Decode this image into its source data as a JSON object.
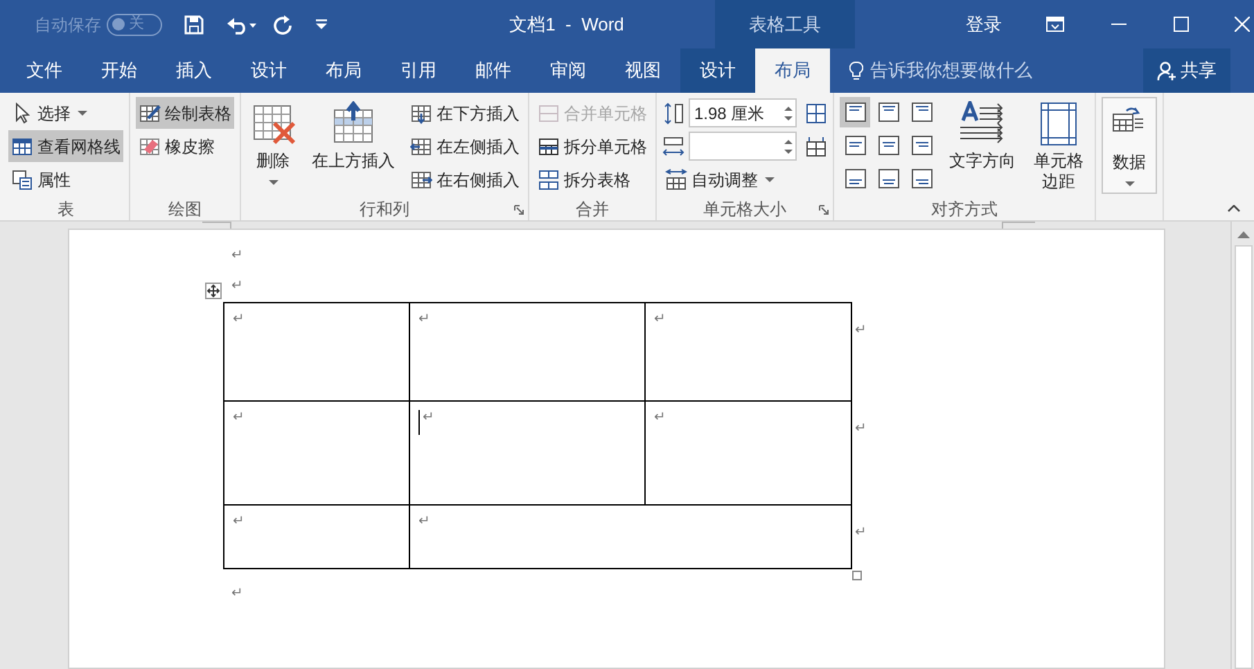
{
  "title_bar": {
    "autosave": {
      "label": "自动保存",
      "toggle": "关",
      "on": false
    },
    "title": "文档1  -  Word",
    "contextual_label": "表格工具",
    "sign_in": "登录"
  },
  "tabs": [
    {
      "label": "文件",
      "kind": "normal",
      "selected": false
    },
    {
      "label": "开始",
      "kind": "normal",
      "selected": false
    },
    {
      "label": "插入",
      "kind": "normal",
      "selected": false
    },
    {
      "label": "设计",
      "kind": "normal",
      "selected": false
    },
    {
      "label": "布局",
      "kind": "normal",
      "selected": false
    },
    {
      "label": "引用",
      "kind": "normal",
      "selected": false
    },
    {
      "label": "邮件",
      "kind": "normal",
      "selected": false
    },
    {
      "label": "审阅",
      "kind": "normal",
      "selected": false
    },
    {
      "label": "视图",
      "kind": "normal",
      "selected": false
    },
    {
      "label": "设计",
      "kind": "contextual",
      "selected": false
    },
    {
      "label": "布局",
      "kind": "contextual",
      "selected": true
    }
  ],
  "tell_me": "告诉我你想要做什么",
  "share": "共享",
  "ribbon": [
    {
      "label": "表",
      "launcher": false,
      "columns": [
        [
          {
            "kind": "small",
            "label": "选择",
            "dropdown": true,
            "selected": false,
            "disabled": false
          },
          {
            "kind": "small",
            "label": "查看网格线",
            "dropdown": false,
            "selected": true,
            "disabled": false
          },
          {
            "kind": "small",
            "label": "属性",
            "dropdown": false,
            "selected": false,
            "disabled": false
          }
        ]
      ]
    },
    {
      "label": "绘图",
      "launcher": false,
      "columns": [
        [
          {
            "kind": "small",
            "label": "绘制表格",
            "dropdown": false,
            "selected": true,
            "disabled": false
          },
          {
            "kind": "small",
            "label": "橡皮擦",
            "dropdown": false,
            "selected": false,
            "disabled": false
          }
        ]
      ]
    },
    {
      "label": "行和列",
      "launcher": true,
      "columns": [
        [
          {
            "kind": "large",
            "label": "删除",
            "dropdown": true
          }
        ],
        [
          {
            "kind": "large",
            "label": "在上方插入",
            "dropdown": false
          }
        ],
        [
          {
            "kind": "small",
            "label": "在下方插入",
            "dropdown": false,
            "selected": false,
            "disabled": false
          },
          {
            "kind": "small",
            "label": "在左侧插入",
            "dropdown": false,
            "selected": false,
            "disabled": false
          },
          {
            "kind": "small",
            "label": "在右侧插入",
            "dropdown": false,
            "selected": false,
            "disabled": false
          }
        ]
      ]
    },
    {
      "label": "合并",
      "launcher": false,
      "columns": [
        [
          {
            "kind": "small",
            "label": "合并单元格",
            "dropdown": false,
            "selected": false,
            "disabled": true
          },
          {
            "kind": "small",
            "label": "拆分单元格",
            "dropdown": false,
            "selected": false,
            "disabled": false
          },
          {
            "kind": "small",
            "label": "拆分表格",
            "dropdown": false,
            "selected": false,
            "disabled": false
          }
        ]
      ]
    },
    {
      "label": "单元格大小",
      "launcher": true,
      "columns": [
        [
          {
            "kind": "spin",
            "value": "1.98 厘米"
          },
          {
            "kind": "spin"
          },
          {
            "kind": "small",
            "label": "自动调整",
            "dropdown": true,
            "selected": false,
            "disabled": false
          }
        ],
        [
          {
            "kind": "icon_button"
          },
          {
            "kind": "icon_button"
          }
        ]
      ]
    },
    {
      "label": "对齐方式",
      "launcher": false,
      "columns": [
        [
          {
            "kind": "align_grid",
            "buttons": [
              {
                "selected": true
              },
              {
                "selected": false
              },
              {
                "selected": false
              },
              {
                "selected": false
              },
              {
                "selected": false
              },
              {
                "selected": false
              },
              {
                "selected": false
              },
              {
                "selected": false
              },
              {
                "selected": false
              }
            ]
          }
        ],
        [
          {
            "kind": "large",
            "label": "文字方向",
            "dropdown": false
          }
        ],
        [
          {
            "kind": "large",
            "label": "单元格边距",
            "dropdown": false
          }
        ]
      ]
    },
    {
      "launcher": false,
      "columns": [
        [
          {
            "kind": "large",
            "label": "数据",
            "dropdown": true,
            "framed": true
          }
        ]
      ]
    }
  ],
  "document": {
    "paragraphs_before": [
      {
        "mark": "↵"
      },
      {
        "mark": "↵"
      }
    ],
    "table": {
      "rows": [
        {
          "cells": [
            {
              "mark": "↵",
              "cursor": false
            },
            {
              "mark": "↵",
              "cursor": false
            },
            {
              "mark": "↵",
              "cursor": false
            }
          ],
          "end_mark": "↵"
        },
        {
          "cells": [
            {
              "mark": "↵",
              "cursor": false
            },
            {
              "mark": "↵",
              "cursor": true
            },
            {
              "mark": "↵",
              "cursor": false
            }
          ],
          "end_mark": "↵"
        },
        {
          "cells": [
            {
              "mark": "↵",
              "cursor": false
            },
            {
              "mark": "↵",
              "cursor": false,
              "colspan": 2
            }
          ],
          "end_mark": "↵"
        }
      ]
    },
    "paragraphs_after": [
      {
        "mark": "↵"
      }
    ]
  }
}
